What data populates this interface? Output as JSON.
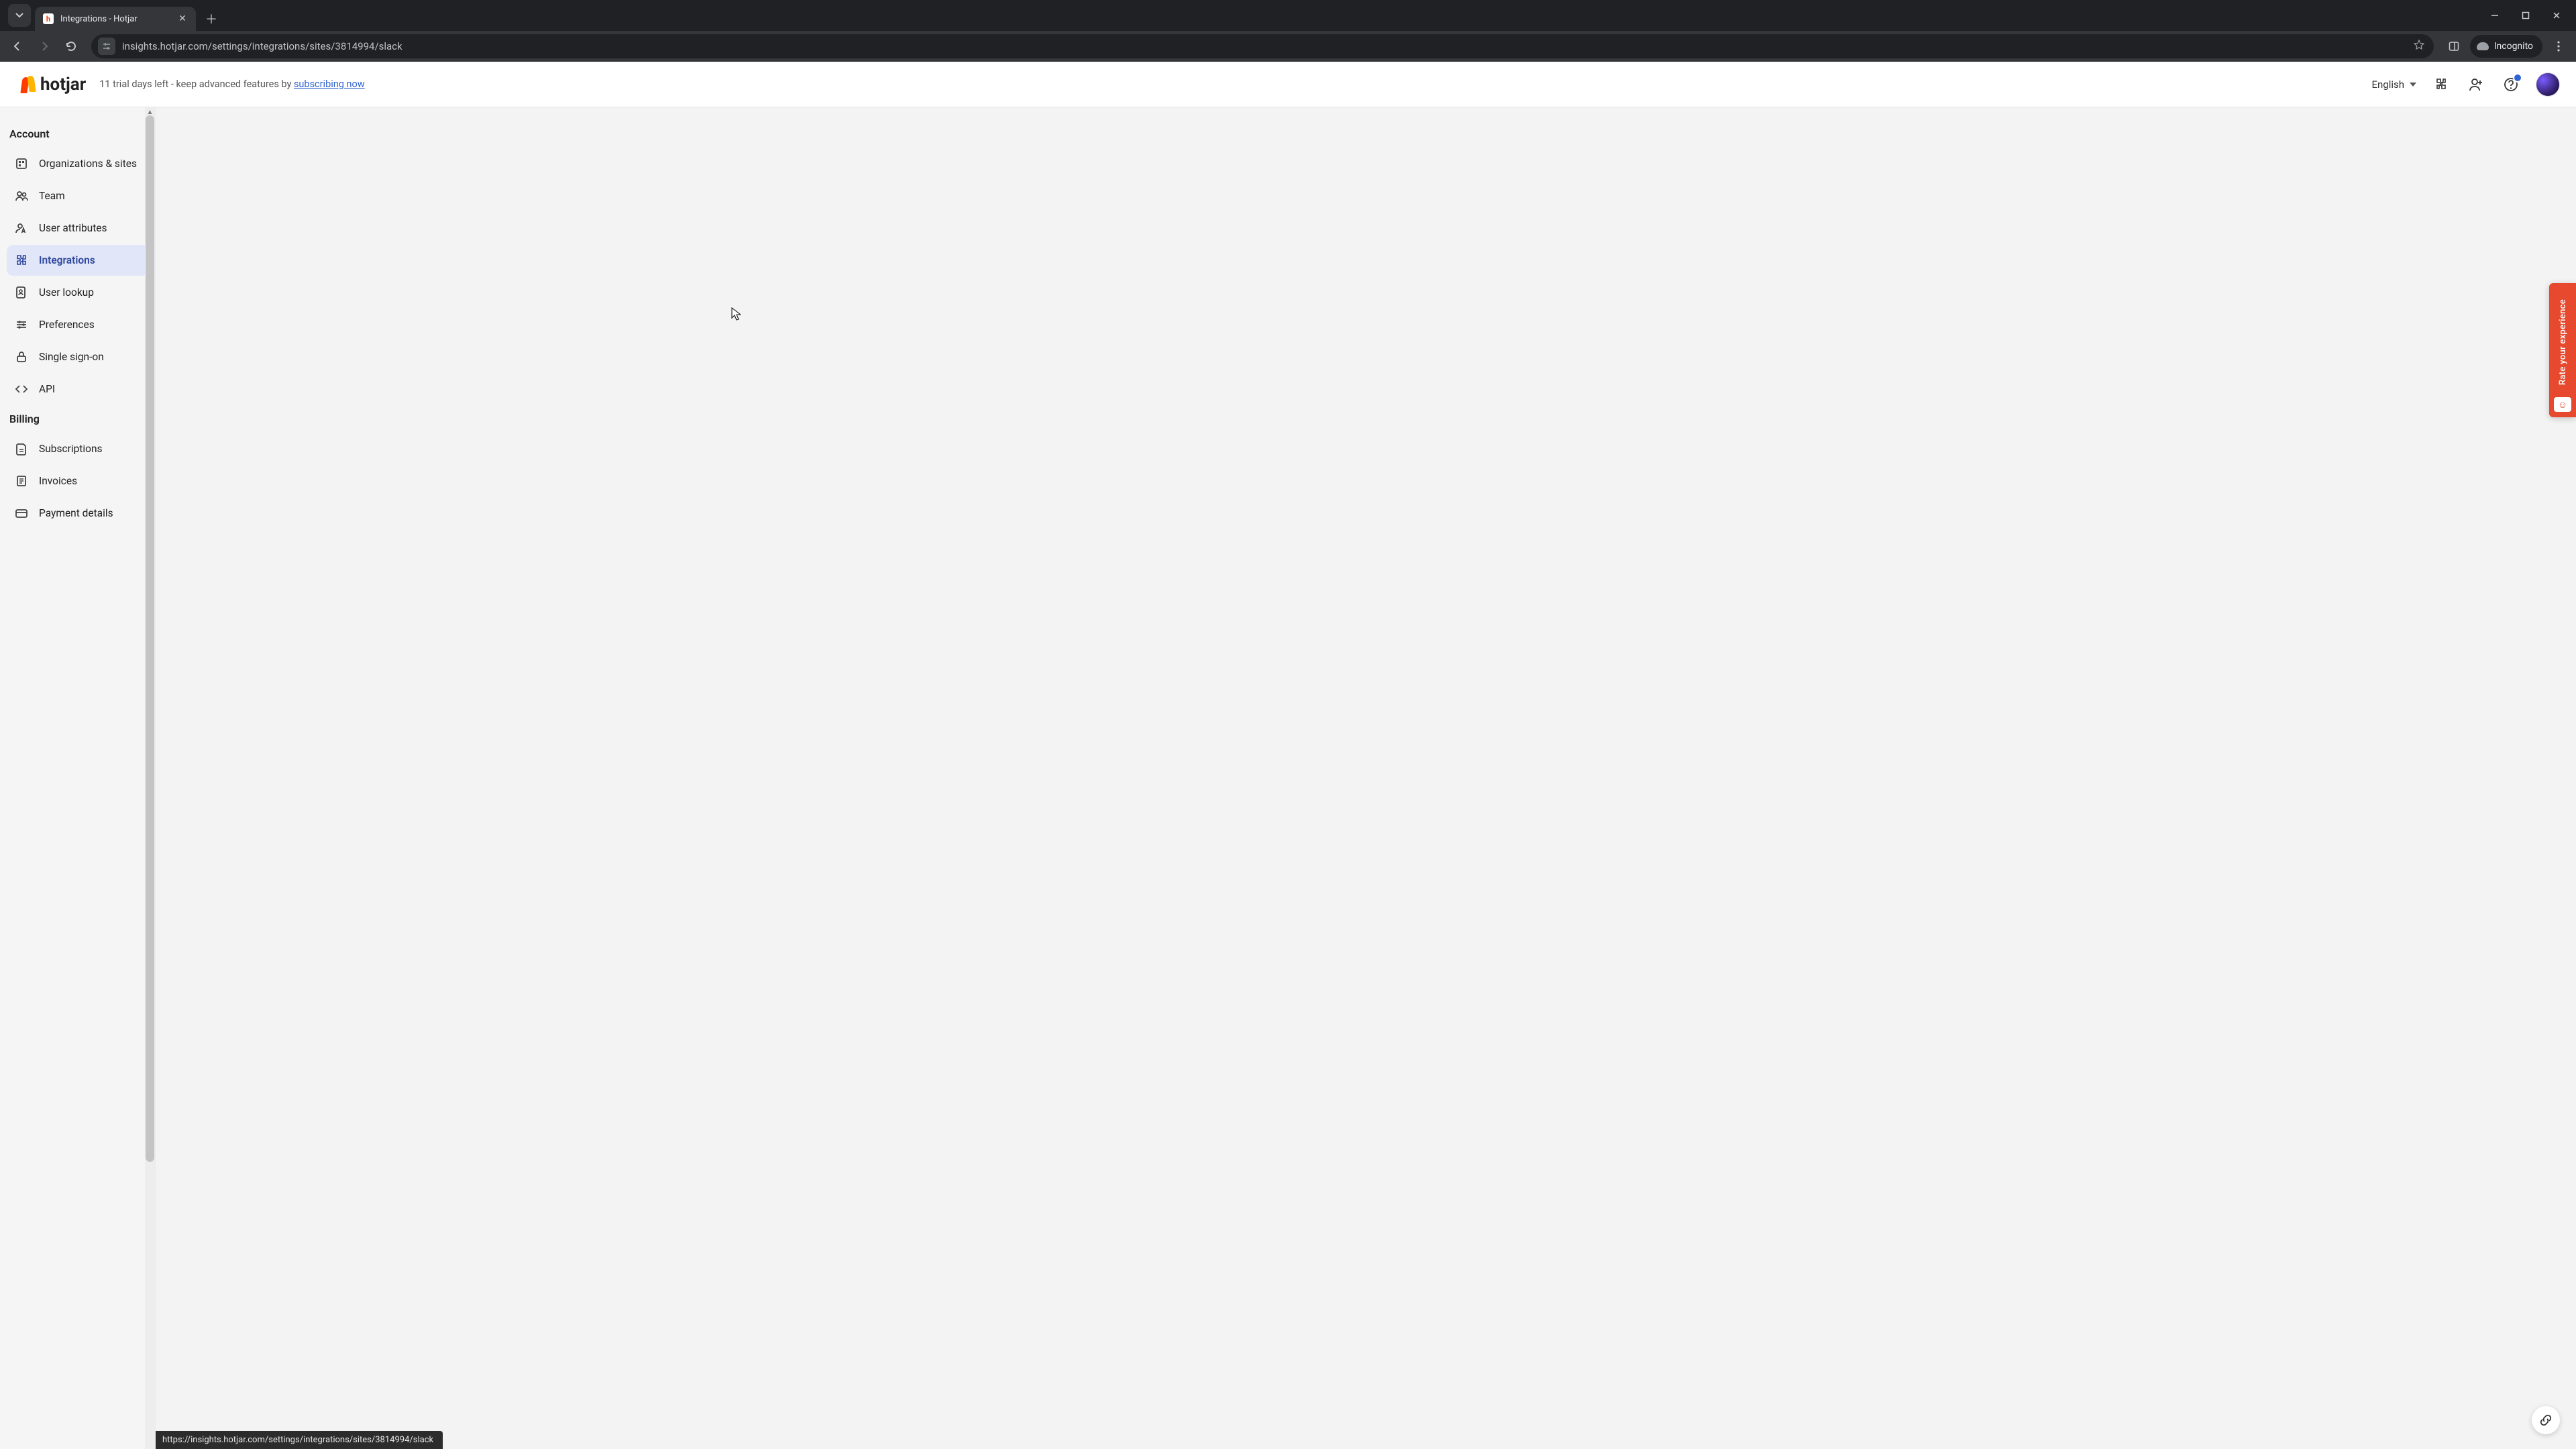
{
  "browser": {
    "tab_title": "Integrations - Hotjar",
    "url": "insights.hotjar.com/settings/integrations/sites/3814994/slack",
    "incognito_label": "Incognito",
    "status_url": "https://insights.hotjar.com/settings/integrations/sites/3814994/slack"
  },
  "header": {
    "logo_text": "hotjar",
    "trial_prefix": "11 trial days left - keep advanced features by ",
    "trial_link": "subscribing now",
    "language": "English"
  },
  "sidebar": {
    "sections": [
      {
        "label": "Account",
        "items": [
          {
            "icon": "organizations-icon",
            "label": "Organizations & sites",
            "active": false
          },
          {
            "icon": "team-icon",
            "label": "Team",
            "active": false
          },
          {
            "icon": "user-attr-icon",
            "label": "User attributes",
            "active": false
          },
          {
            "icon": "integrations-icon",
            "label": "Integrations",
            "active": true
          },
          {
            "icon": "user-lookup-icon",
            "label": "User lookup",
            "active": false
          },
          {
            "icon": "preferences-icon",
            "label": "Preferences",
            "active": false
          },
          {
            "icon": "sso-icon",
            "label": "Single sign-on",
            "active": false
          },
          {
            "icon": "api-icon",
            "label": "API",
            "active": false
          }
        ]
      },
      {
        "label": "Billing",
        "items": [
          {
            "icon": "subscriptions-icon",
            "label": "Subscriptions",
            "active": false
          },
          {
            "icon": "invoices-icon",
            "label": "Invoices",
            "active": false
          },
          {
            "icon": "payment-icon",
            "label": "Payment details",
            "active": false
          }
        ]
      }
    ]
  },
  "feedback": {
    "label": "Rate your experience"
  }
}
